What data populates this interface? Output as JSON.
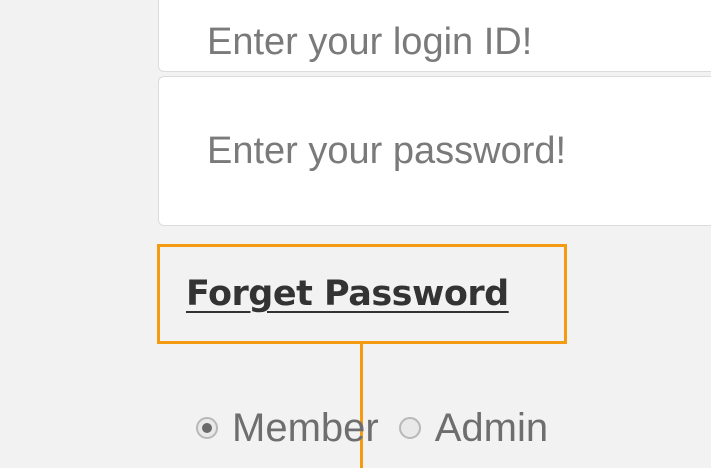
{
  "login_form": {
    "login_id": {
      "placeholder": "Enter your login ID!",
      "value": ""
    },
    "password": {
      "placeholder": "Enter your password!",
      "value": ""
    },
    "forget_password_link": "Forget Password",
    "role_options": [
      {
        "label": "Member",
        "selected": true
      },
      {
        "label": "Admin",
        "selected": false
      }
    ]
  },
  "colors": {
    "highlight": "#f39c12",
    "page_background": "#f2f2f2",
    "field_background": "#ffffff"
  }
}
